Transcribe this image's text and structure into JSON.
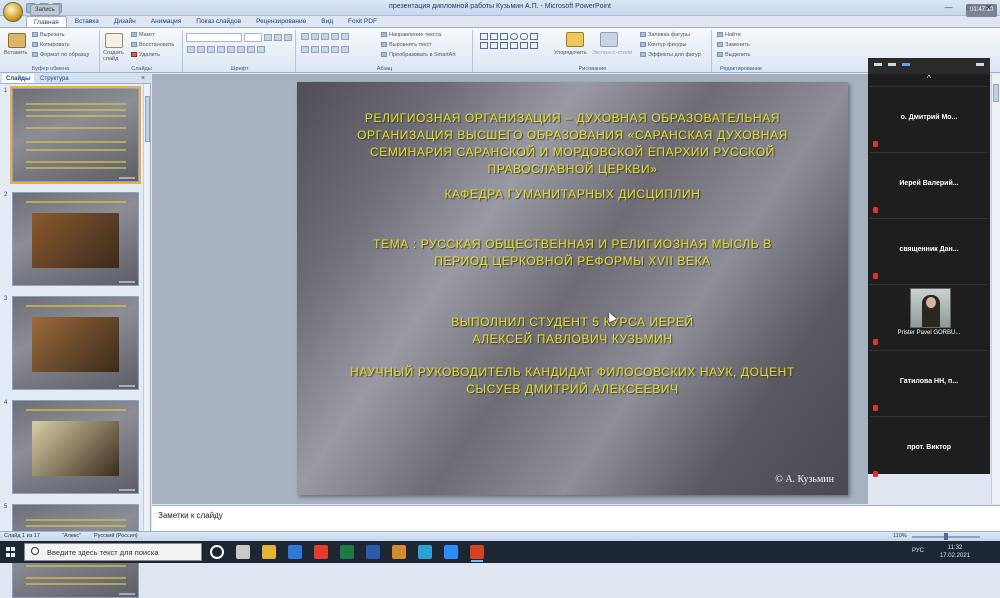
{
  "window": {
    "title": "презентация дипломной работы Кузьмин А.П. - Microsoft PowerPoint",
    "rec_badge": "Запись",
    "clock_badge": "01:47:10",
    "controls": [
      "—",
      "□",
      "✕"
    ]
  },
  "tabs": [
    "Главная",
    "Вставка",
    "Дизайн",
    "Анимация",
    "Показ слайдов",
    "Рецензирование",
    "Вид",
    "Foxit PDF"
  ],
  "ribbon": {
    "clipboard": {
      "paste": "Вставить",
      "cut": "Вырезать",
      "copy": "Копировать",
      "format": "Формат по образцу",
      "label": "Буфер обмена"
    },
    "slides": {
      "create": "Создать слайд",
      "layout": "Макет",
      "reset": "Восстановить",
      "delete": "Удалить",
      "label": "Слайды"
    },
    "font": {
      "label": "Шрифт"
    },
    "paragraph": {
      "direction": "Направление текста",
      "align": "Выровнять текст",
      "smartart": "Преобразовать в SmartArt",
      "label": "Абзац"
    },
    "drawing": {
      "arrange": "Упорядочить",
      "styles": "Экспресс-стили",
      "fill": "Заливка фигуры",
      "outline": "Контур фигуры",
      "effects": "Эффекты для фигур",
      "label": "Рисование"
    },
    "editing": {
      "find": "Найти",
      "replace": "Заменить",
      "select": "Выделить",
      "label": "Редактирование"
    }
  },
  "left_panel": {
    "tabs": [
      "Слайды",
      "Структура"
    ],
    "close": "×",
    "slides": [
      {
        "num": "1",
        "kind": "text",
        "selected": true
      },
      {
        "num": "2",
        "kind": "painting",
        "color": "#8a5a2e"
      },
      {
        "num": "3",
        "kind": "painting",
        "color": "#9a6a3a"
      },
      {
        "num": "4",
        "kind": "painting",
        "color": "#d8cfa8"
      },
      {
        "num": "5",
        "kind": "text",
        "selected": false
      }
    ]
  },
  "slide": {
    "org": "РЕЛИГИОЗНАЯ ОРГАНИЗАЦИЯ – ДУХОВНАЯ ОБРАЗОВАТЕЛЬНАЯ ОРГАНИЗАЦИЯ ВЫСШЕГО ОБРАЗОВАНИЯ «САРАНСКАЯ ДУХОВНАЯ СЕМИНАРИЯ САРАНСКОЙ И МОРДОВСКОЙ ЕПАРХИИ РУССКОЙ ПРАВОСЛАВНОЙ ЦЕРКВИ»",
    "department": "КАФЕДРА ГУМАНИТАРНЫХ ДИСЦИПЛИН",
    "theme": "ТЕМА : РУССКАЯ ОБЩЕСТВЕННАЯ И РЕЛИГИОЗНАЯ МЫСЛЬ В ПЕРИОД ЦЕРКОВНОЙ РЕФОРМЫ XVII ВЕКА",
    "student": "ВЫПОЛНИЛ СТУДЕНТ 5 КУРСА ИЕРЕЙ АЛЕКСЕЙ ПАВЛОВИЧ КУЗЬМИН",
    "advisor": "НАУЧНЫЙ РУКОВОДИТЕЛЬ КАНДИДАТ ФИЛОСОВСКИХ НАУК, ДОЦЕНТ СЫСУЕВ ДМИТРИЙ АЛЕКСЕЕВИЧ",
    "signature": "© А. Кузьмин",
    "text_color": "#e5de30"
  },
  "video_panel": {
    "chevron": "^",
    "participants": [
      {
        "name": "о. Дмитрий Мо...",
        "video": false
      },
      {
        "name": "Иерей Валерий...",
        "video": false
      },
      {
        "name": "священник Дан...",
        "video": false
      },
      {
        "name": "Prister Pavel GORBU...",
        "video": true
      },
      {
        "name": "Гатилова НН, п...",
        "video": false
      },
      {
        "name": "прот. Виктор",
        "video": false
      }
    ]
  },
  "notes": {
    "placeholder": "Заметки к слайду"
  },
  "statusbar": {
    "slide": "Слайд 1 из 17",
    "theme": "\"Алекс\"",
    "lang": "Русский (Россия)",
    "zoom": "110%"
  },
  "taskbar": {
    "search_placeholder": "Введите здесь текст для поиска",
    "apps": [
      {
        "name": "cortana-icon",
        "color": "#ffffff"
      },
      {
        "name": "task-view-icon",
        "color": "#c9c9c9"
      },
      {
        "name": "explorer-icon",
        "color": "#e5b53a"
      },
      {
        "name": "mail-icon",
        "color": "#2f7ad6"
      },
      {
        "name": "yandex-icon",
        "color": "#e53c2e"
      },
      {
        "name": "excel-icon",
        "color": "#1f7a45"
      },
      {
        "name": "word-icon",
        "color": "#2b5ca8"
      },
      {
        "name": "files-icon",
        "color": "#d28b2e"
      },
      {
        "name": "edge-icon",
        "color": "#2ea0d8"
      },
      {
        "name": "zoom-icon",
        "color": "#2d8cff"
      },
      {
        "name": "powerpoint-icon",
        "color": "#d04423"
      }
    ],
    "lang": "РУС",
    "time": "11:32",
    "date": "17.02.2021"
  }
}
